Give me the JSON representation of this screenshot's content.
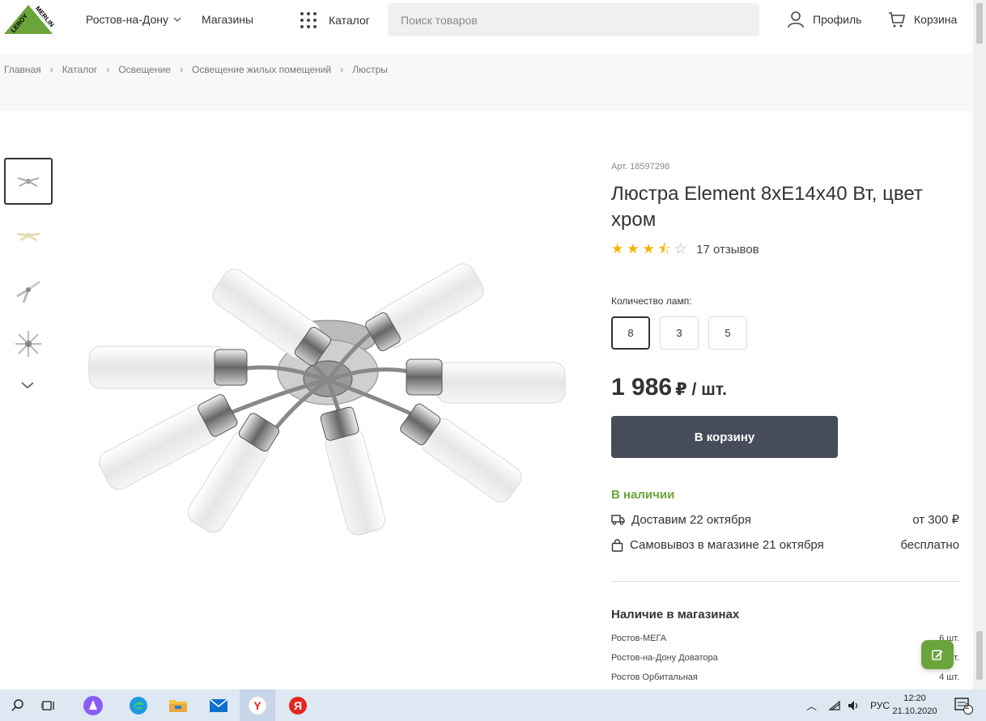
{
  "header": {
    "city": "Ростов-на-Дону",
    "shops": "Магазины",
    "catalog": "Каталог",
    "search_placeholder": "Поиск товаров",
    "profile": "Профиль",
    "cart": "Корзина"
  },
  "breadcrumbs": [
    "Главная",
    "Каталог",
    "Освещение",
    "Освещение жилых помещений",
    "Люстры"
  ],
  "product": {
    "article": "Арт. 18597298",
    "title": "Люстра Element 8хE14х40 Вт, цвет хром",
    "rating": 3.5,
    "reviews": "17 отзывов",
    "lamps_label": "Количество ламп:",
    "lamp_options": [
      "8",
      "3",
      "5"
    ],
    "selected_lamp": "8",
    "price": "1 986",
    "price_unit": "₽ / шт.",
    "buy_label": "В корзину",
    "in_stock": "В наличии",
    "delivery_label": "Доставим 22 октября",
    "delivery_price": "от 300 ₽",
    "pickup_label": "Самовывоз в магазине 21 октября",
    "pickup_price": "бесплатно"
  },
  "stores": {
    "title": "Наличие в магазинах",
    "items": [
      {
        "name": "Ростов-МЕГА",
        "qty": "6 шт."
      },
      {
        "name": "Ростов-на-Дону Доватора",
        "qty": "шт."
      },
      {
        "name": "Ростов Орбитальная",
        "qty": "4 шт."
      }
    ]
  },
  "taskbar": {
    "lang": "РУС",
    "time": "12:20",
    "date": "21.10.2020",
    "notifications": "2"
  },
  "colors": {
    "brand_green": "#6aa43b",
    "buy_button": "#474c5a",
    "star": "#f5b400"
  }
}
